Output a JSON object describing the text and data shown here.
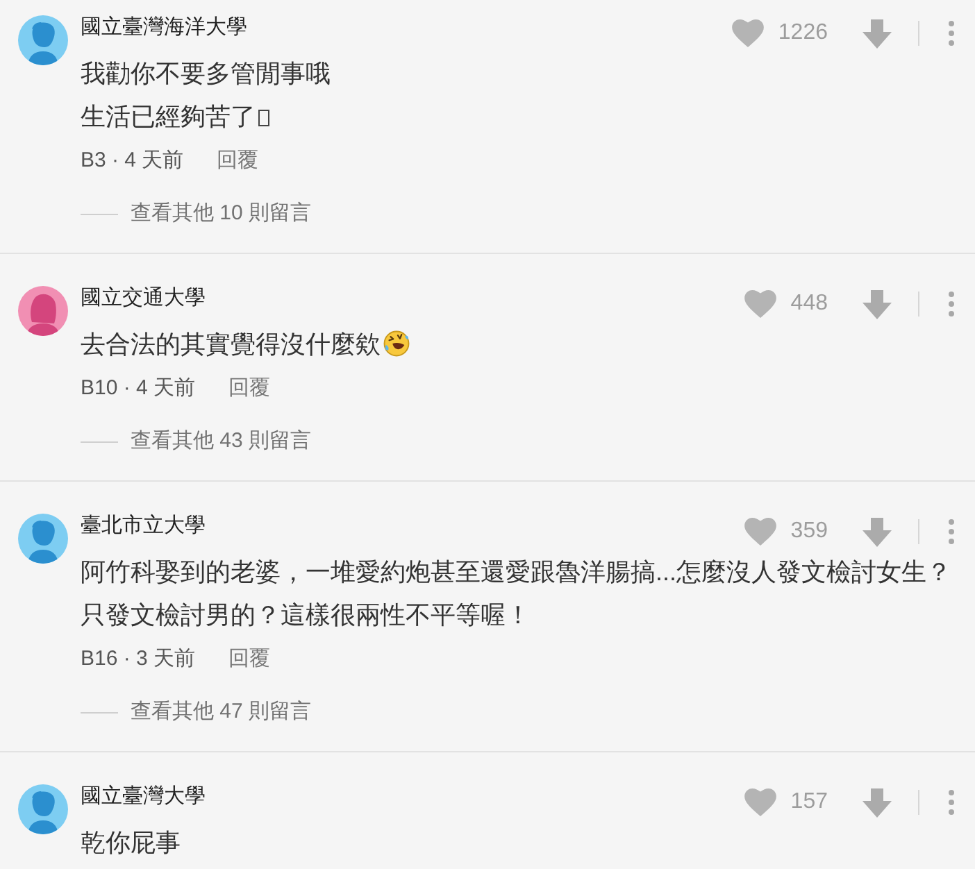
{
  "comments": [
    {
      "author": "國立臺灣海洋大學",
      "avatar": {
        "kind": "male"
      },
      "lines": [
        "我勸你不要多管閒事哦",
        "生活已經夠苦了"
      ],
      "trailing_icon": {
        "kind": "missing-glyph"
      },
      "likes": "1226",
      "meta": "B3 · 4 天前",
      "reply": "回覆",
      "more_replies": "查看其他 10 則留言"
    },
    {
      "author": "國立交通大學",
      "avatar": {
        "kind": "female"
      },
      "lines": [
        "去合法的其實覺得沒什麼欸"
      ],
      "trailing_icon": {
        "kind": "laughing-emoji"
      },
      "likes": "448",
      "meta": "B10 · 4 天前",
      "reply": "回覆",
      "more_replies": "查看其他 43 則留言"
    },
    {
      "author": "臺北市立大學",
      "avatar": {
        "kind": "male"
      },
      "lines": [
        "阿竹科娶到的老婆，一堆愛約炮甚至還愛跟魯洋腸搞...怎麼沒人發文檢討女生？只發文檢討男的？這樣很兩性不平等喔！"
      ],
      "likes": "359",
      "meta": "B16 · 3 天前",
      "reply": "回覆",
      "more_replies": "查看其他 47 則留言"
    },
    {
      "author": "國立臺灣大學",
      "avatar": {
        "kind": "male"
      },
      "lines": [
        "乾你屁事"
      ],
      "likes": "157"
    }
  ]
}
